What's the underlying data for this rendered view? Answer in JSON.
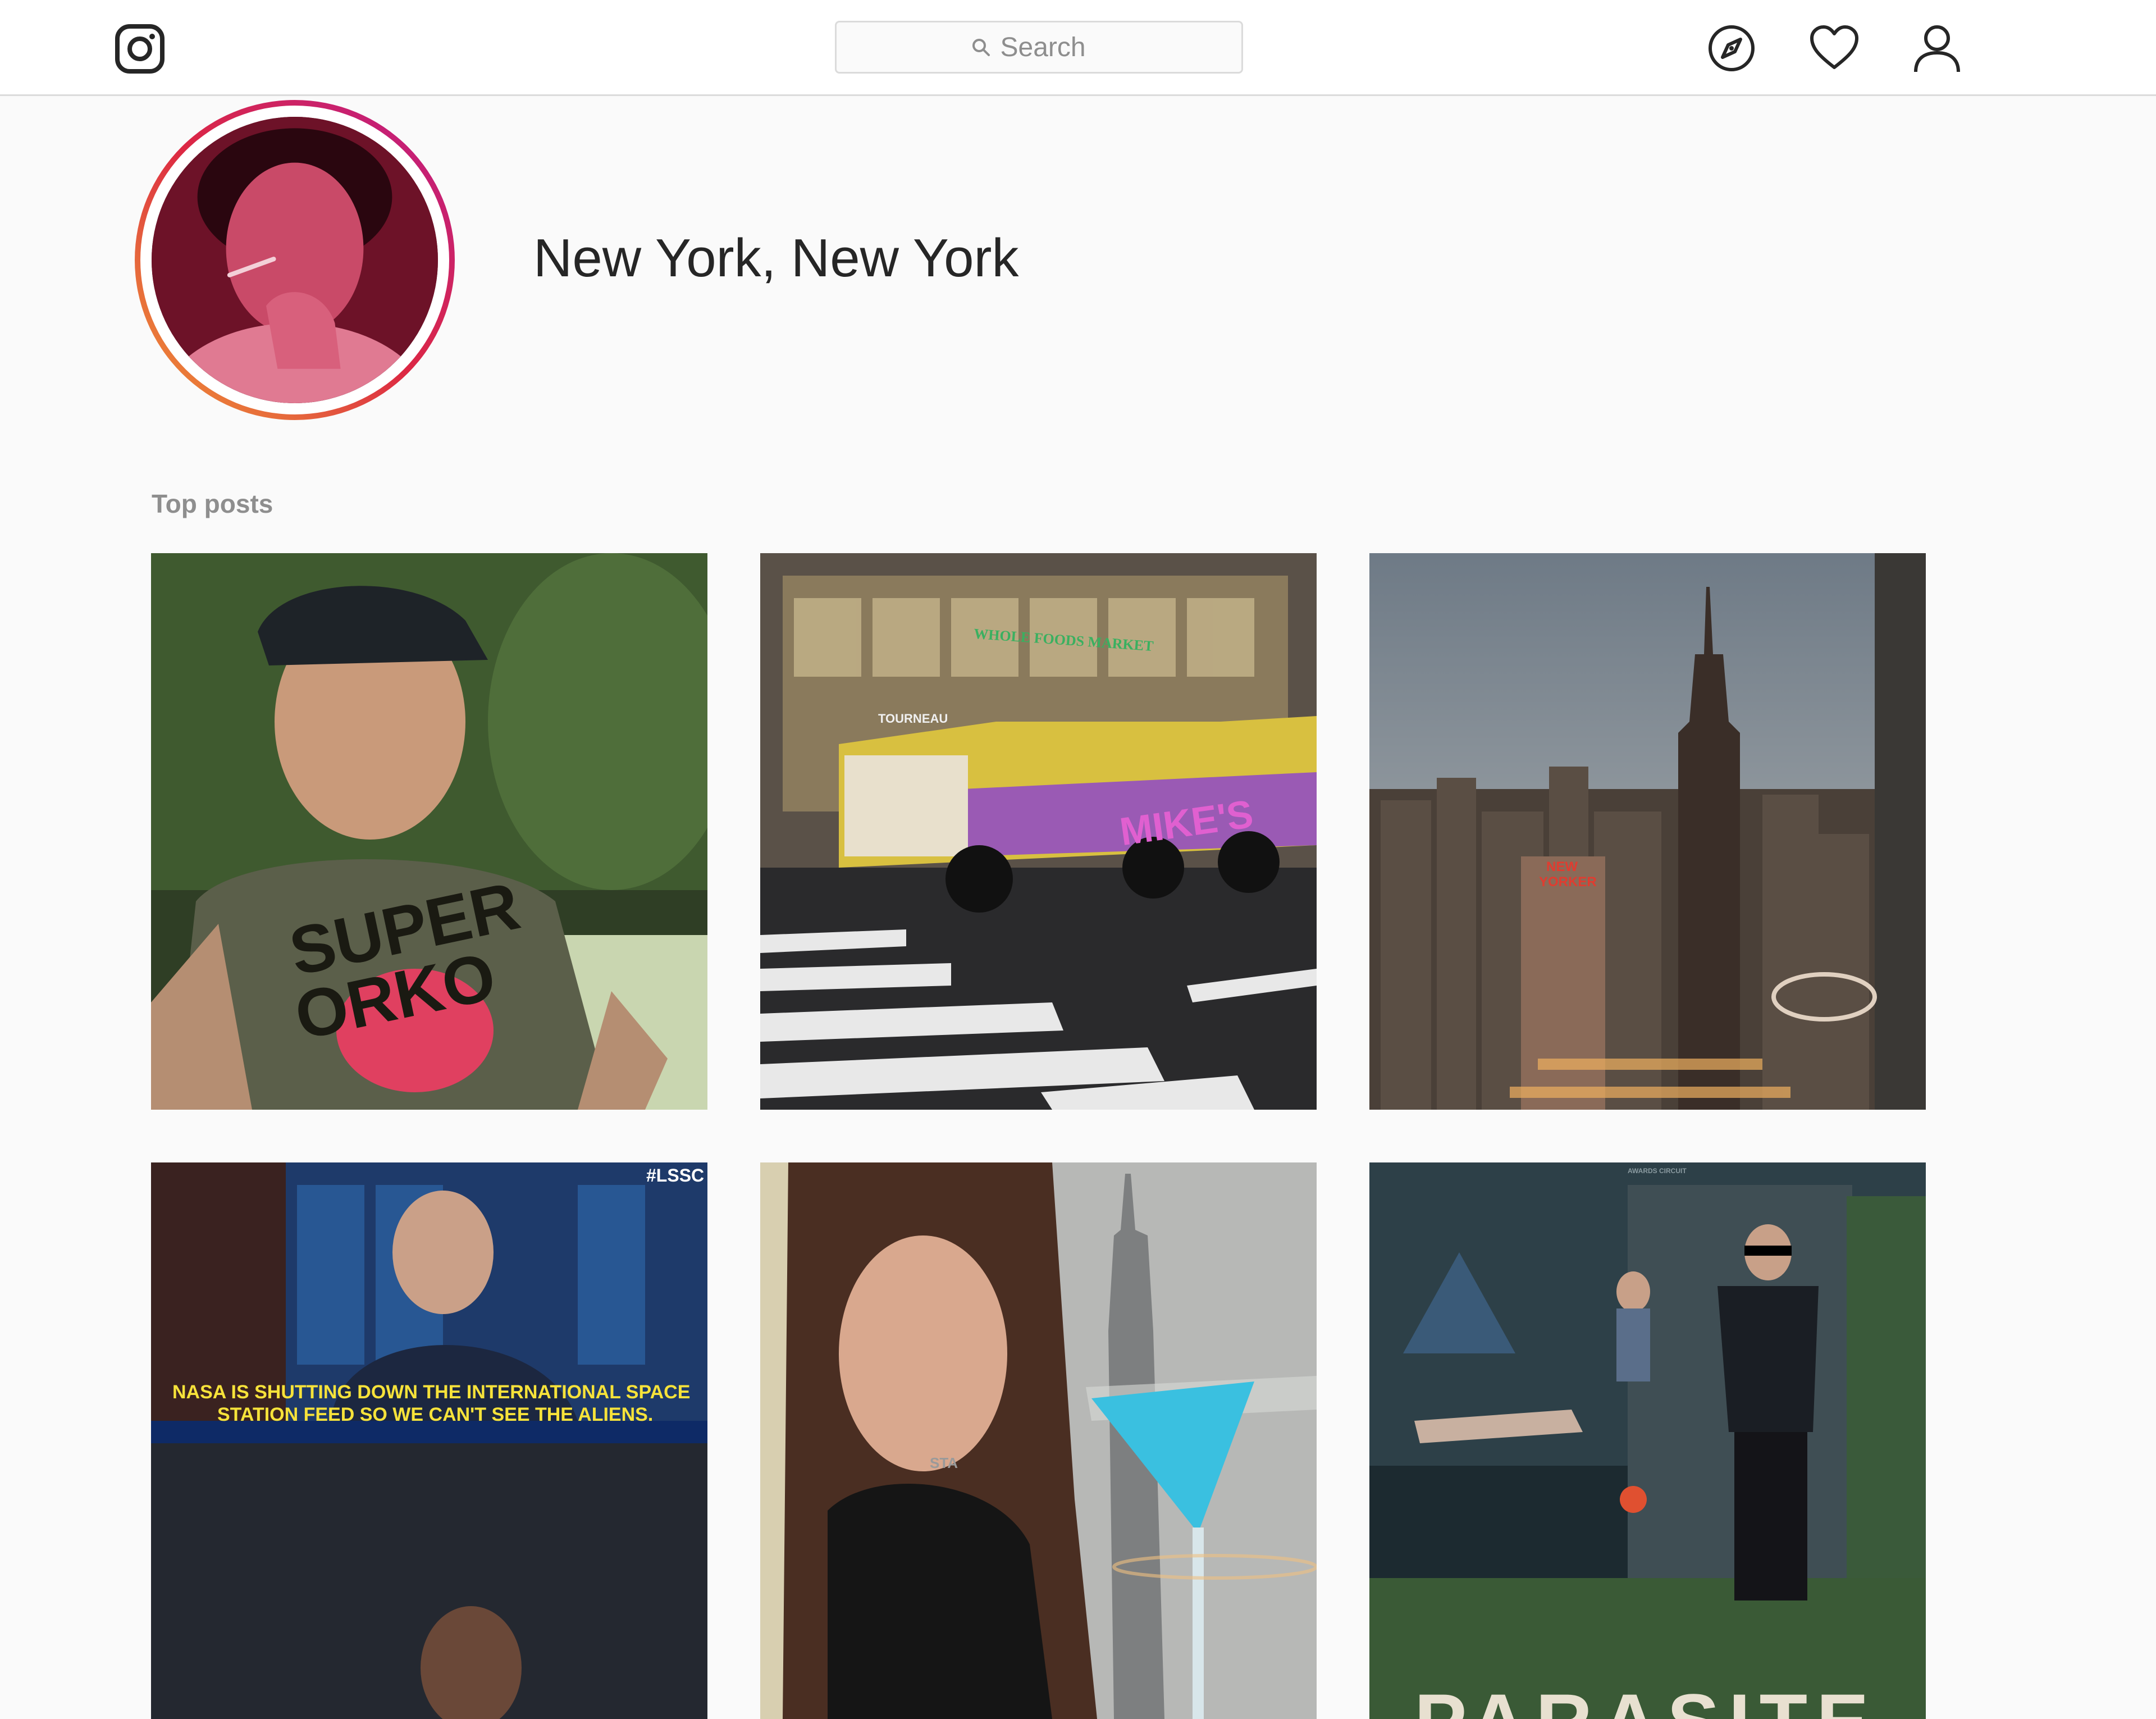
{
  "nav": {
    "search_placeholder": "Search",
    "icons": [
      "instagram-logo-icon",
      "search-icon",
      "compass-icon",
      "heart-icon",
      "user-icon"
    ]
  },
  "location": {
    "title": "New York, New York"
  },
  "sections": {
    "top_posts": "Top posts"
  },
  "posts": [
    {
      "id": "post-1",
      "overlay_text": [
        "SUPER",
        "ORKO"
      ]
    },
    {
      "id": "post-2",
      "overlay_text": [
        "WHOLE FOODS MARKET",
        "TOURNEAU",
        "MIKE'S"
      ]
    },
    {
      "id": "post-3",
      "overlay_text": [
        "NEW",
        "YORKER"
      ]
    },
    {
      "id": "post-4",
      "overlay_text": [
        "#LSSC",
        "NASA IS SHUTTING DOWN THE INTERNATIONAL SPACE",
        "STATION FEED SO WE CAN'T SEE THE ALIENS."
      ]
    },
    {
      "id": "post-5",
      "overlay_text": [
        "STA"
      ]
    },
    {
      "id": "post-6",
      "overlay_text": [
        "AWARDS CIRCUIT",
        "PARASITE"
      ]
    }
  ],
  "colors": {
    "background": "#fafafa",
    "border": "#dbdbdb",
    "text": "#262626",
    "muted": "#8e8e8e",
    "story_ring": [
      "#f09433",
      "#dc2743",
      "#bc1888"
    ]
  }
}
